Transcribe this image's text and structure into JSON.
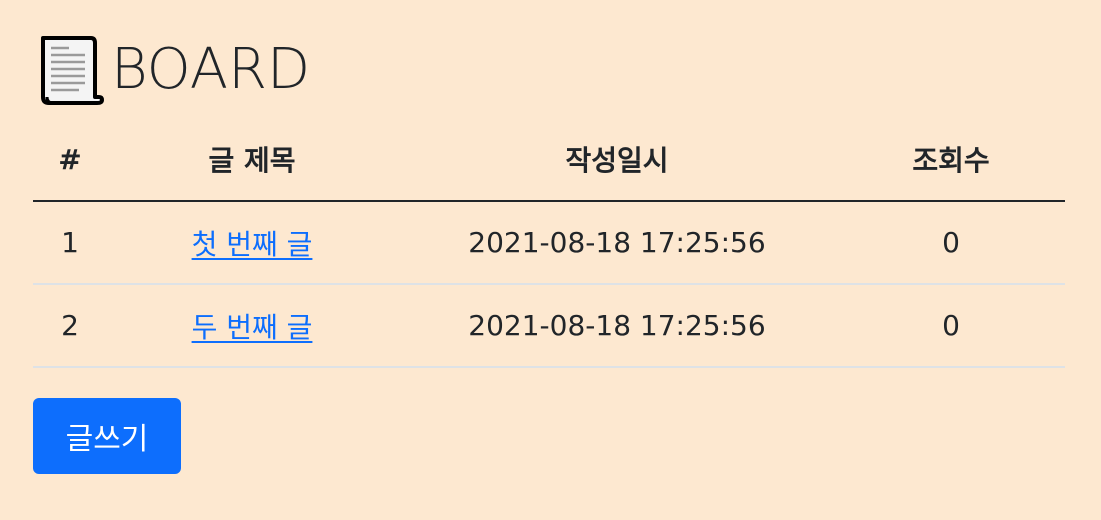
{
  "header": {
    "title": "BOARD",
    "icon": "document-icon"
  },
  "table": {
    "columns": [
      "#",
      "글 제목",
      "작성일시",
      "조회수"
    ],
    "rows": [
      {
        "num": "1",
        "title": "첫 번째 글",
        "date": "2021-08-18 17:25:56",
        "views": "0"
      },
      {
        "num": "2",
        "title": "두 번째 글",
        "date": "2021-08-18 17:25:56",
        "views": "0"
      }
    ]
  },
  "actions": {
    "write_label": "글쓰기"
  },
  "colors": {
    "background": "#fde8d0",
    "link": "#0d6efd",
    "button": "#0d6efd"
  }
}
